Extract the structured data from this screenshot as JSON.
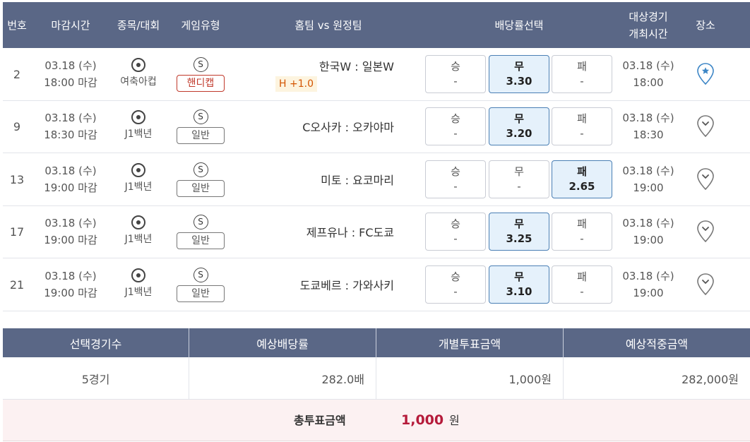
{
  "header": {
    "num": "번호",
    "deadline": "마감시간",
    "league": "종목/대회",
    "game_type": "게임유형",
    "teams": "홈팀 vs 원정팀",
    "odds": "배당률선택",
    "target_line1": "대상경기",
    "target_line2": "개최시간",
    "venue": "장소"
  },
  "icons": {
    "sport": "soccer-ball-icon",
    "type": "s-badge-icon",
    "venue": "location-pin-icon"
  },
  "colors": {
    "header_bg": "#5a6786",
    "selected_bg": "#e5f1fb",
    "selected_border": "#4a7fb4",
    "handicap": "#c0392b",
    "total_amount": "#b51a3a"
  },
  "rows": [
    {
      "num": "2",
      "date": "03.18 (수)",
      "deadline": "18:00 마감",
      "league": "여축아컵",
      "type_letter": "S",
      "game_type": "핸디캡",
      "matchup": "한국W : 일본W",
      "handicap": "H +1.0",
      "odds": [
        {
          "label": "승",
          "value": "-"
        },
        {
          "label": "무",
          "value": "3.30"
        },
        {
          "label": "패",
          "value": "-"
        }
      ],
      "selected": 1,
      "game_date": "03.18 (수)",
      "game_time": "18:00",
      "venue_starred": true
    },
    {
      "num": "9",
      "date": "03.18 (수)",
      "deadline": "18:30 마감",
      "league": "J1백년",
      "type_letter": "S",
      "game_type": "일반",
      "matchup": "C오사카 : 오카야마",
      "handicap": "",
      "odds": [
        {
          "label": "승",
          "value": "-"
        },
        {
          "label": "무",
          "value": "3.20"
        },
        {
          "label": "패",
          "value": "-"
        }
      ],
      "selected": 1,
      "game_date": "03.18 (수)",
      "game_time": "18:30",
      "venue_starred": false
    },
    {
      "num": "13",
      "date": "03.18 (수)",
      "deadline": "19:00 마감",
      "league": "J1백년",
      "type_letter": "S",
      "game_type": "일반",
      "matchup": "미토 : 요코마리",
      "handicap": "",
      "odds": [
        {
          "label": "승",
          "value": "-"
        },
        {
          "label": "무",
          "value": "-"
        },
        {
          "label": "패",
          "value": "2.65"
        }
      ],
      "selected": 2,
      "game_date": "03.18 (수)",
      "game_time": "19:00",
      "venue_starred": false
    },
    {
      "num": "17",
      "date": "03.18 (수)",
      "deadline": "19:00 마감",
      "league": "J1백년",
      "type_letter": "S",
      "game_type": "일반",
      "matchup": "제프유나 : FC도쿄",
      "handicap": "",
      "odds": [
        {
          "label": "승",
          "value": "-"
        },
        {
          "label": "무",
          "value": "3.25"
        },
        {
          "label": "패",
          "value": "-"
        }
      ],
      "selected": 1,
      "game_date": "03.18 (수)",
      "game_time": "19:00",
      "venue_starred": false
    },
    {
      "num": "21",
      "date": "03.18 (수)",
      "deadline": "19:00 마감",
      "league": "J1백년",
      "type_letter": "S",
      "game_type": "일반",
      "matchup": "도쿄베르 : 가와사키",
      "handicap": "",
      "odds": [
        {
          "label": "승",
          "value": "-"
        },
        {
          "label": "무",
          "value": "3.10"
        },
        {
          "label": "패",
          "value": "-"
        }
      ],
      "selected": 1,
      "game_date": "03.18 (수)",
      "game_time": "19:00",
      "venue_starred": false
    }
  ],
  "summary": {
    "headers": [
      "선택경기수",
      "예상배당률",
      "개별투표금액",
      "예상적중금액"
    ],
    "values": [
      "5경기",
      "282.0배",
      "1,000원",
      "282,000원"
    ],
    "total_label": "총투표금액",
    "total_amount": "1,000",
    "total_unit": "원"
  }
}
